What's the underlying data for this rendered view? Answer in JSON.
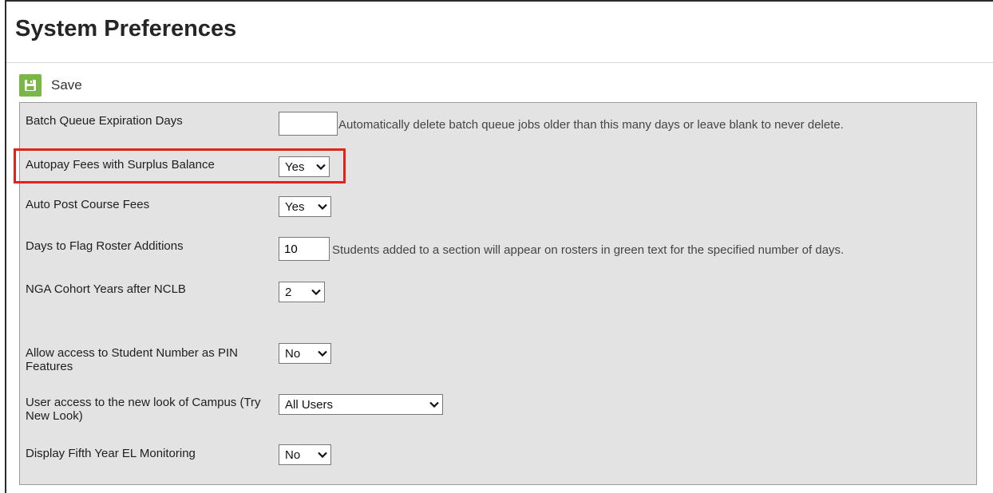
{
  "page": {
    "title": "System Preferences"
  },
  "toolbar": {
    "save_label": "Save",
    "save_icon": "floppy-disk-icon"
  },
  "preferences": {
    "batch_queue": {
      "label": "Batch Queue Expiration Days",
      "value": "",
      "help": "Automatically delete batch queue jobs older than this many days or leave blank to never delete."
    },
    "autopay": {
      "label": "Autopay Fees with Surplus Balance",
      "value": "Yes"
    },
    "auto_post": {
      "label": "Auto Post Course Fees",
      "value": "Yes"
    },
    "days_flag": {
      "label": "Days to Flag Roster Additions",
      "value": "10",
      "help": "Students added to a section will appear on rosters in green text for the specified number of days."
    },
    "nga_cohort": {
      "label": "NGA Cohort Years after NCLB",
      "value": "2"
    },
    "student_pin": {
      "label": "Allow access to Student Number as PIN Features",
      "value": "No"
    },
    "new_look": {
      "label": "User access to the new look of Campus (Try New Look)",
      "value": "All Users"
    },
    "fifth_year_el": {
      "label": "Display Fifth Year EL Monitoring",
      "value": "No"
    }
  },
  "colors": {
    "highlight": "#e2231a",
    "save_icon_bg": "#7ab648",
    "panel_bg": "#e3e3e3"
  }
}
